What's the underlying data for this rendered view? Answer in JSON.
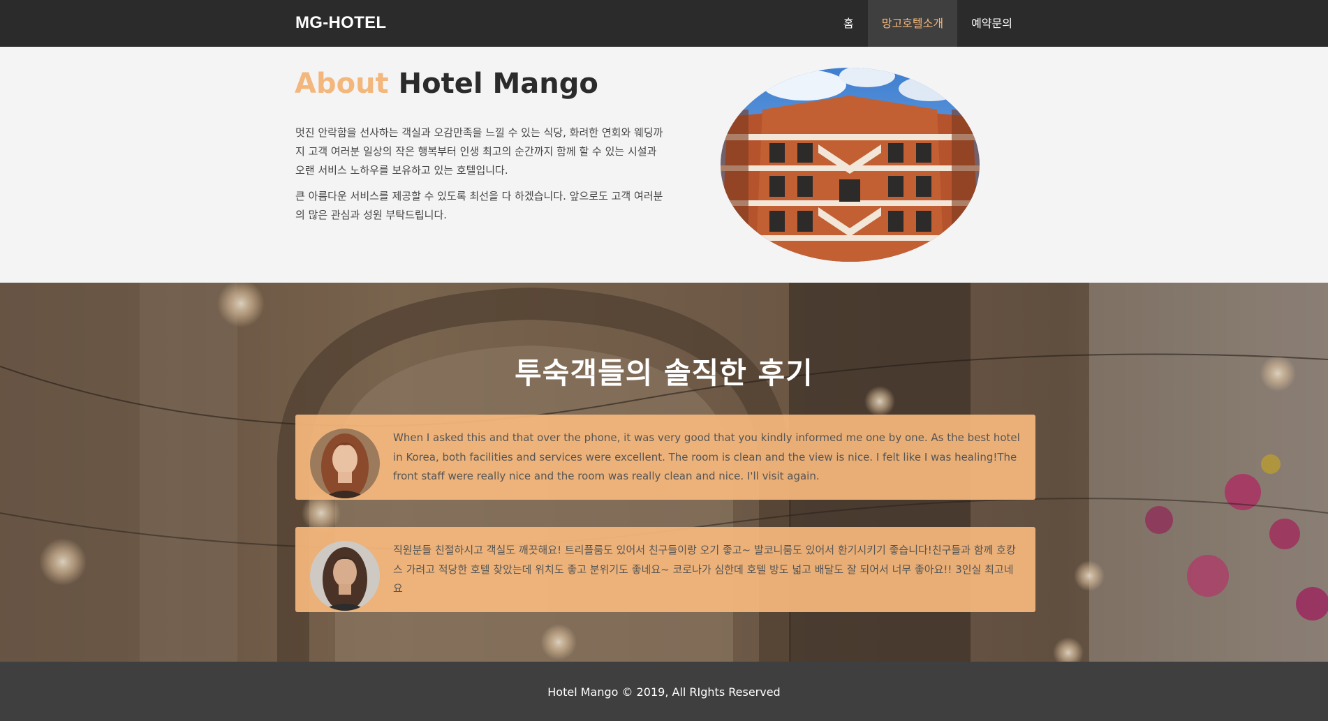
{
  "navbar": {
    "brand": "MG-HOTEL",
    "items": [
      {
        "label": "홈",
        "active": false
      },
      {
        "label": "망고호텔소개",
        "active": true
      },
      {
        "label": "예약문의",
        "active": false
      }
    ]
  },
  "about": {
    "title_accent": "About",
    "title_rest": "Hotel Mango",
    "paragraphs": [
      "멋진 안락함을 선사하는 객실과 오감만족을 느낄 수 있는 식당, 화려한 연회와 웨딩까지 고객 여러분 일상의 작은 행복부터 인생 최고의 순간까지 함께 할 수 있는 시설과 오랜 서비스 노하우를 보유하고 있는 호텔입니다.",
      "큰 아름다운 서비스를 제공할 수 있도록 최선을 다 하겠습니다. 앞으로도 고객 여러분의 많은 관심과 성원 부탁드립니다."
    ]
  },
  "reviews": {
    "title": "투숙객들의 솔직한 후기",
    "items": [
      {
        "text": "When I asked this and that over the phone, it was very good that you kindly informed me one by one. As the best hotel in Korea, both facilities and services were excellent. The room is clean and the view is nice. I felt like I was healing!The front staff were really nice and the room was really clean and nice. I'll visit again."
      },
      {
        "text": "직원분들 친절하시고 객실도 깨끗해요! 트리플룸도 있어서 친구들이랑 오기 좋고~ 발코니룸도 있어서 환기시키기 좋습니다!친구들과 함께 호캉스 가려고 적당한 호텔 찾았는데 위치도 좋고 분위기도 좋네요~ 코로나가 심한데 호텔 방도 넓고 배달도 잘 되어서 너무 좋아요!! 3인실 최고네요"
      }
    ]
  },
  "footer": {
    "text": "Hotel Mango © 2019, All RIghts Reserved"
  },
  "colors": {
    "accent": "#f3b77d",
    "navbar_bg": "#2b2b2b",
    "footer_bg": "#3f3f3f",
    "card_bg": "#f6b87d"
  }
}
